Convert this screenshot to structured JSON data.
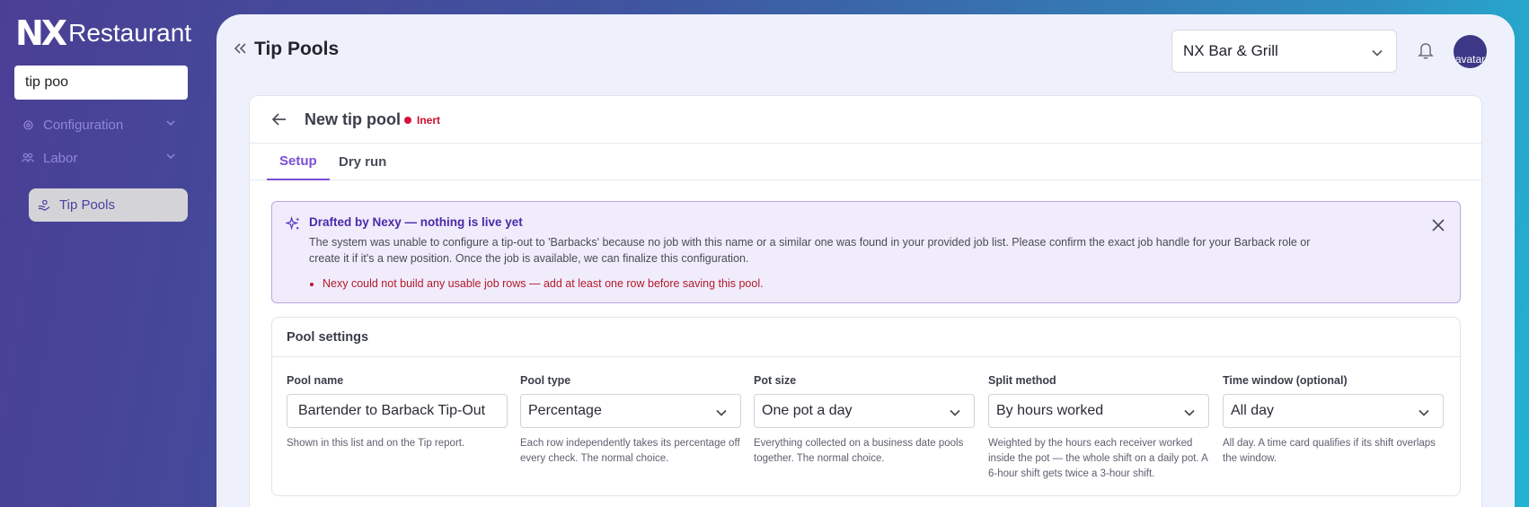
{
  "brand": {
    "logo_mark": "NX",
    "logo_text": "Restaurant"
  },
  "sidebar": {
    "search": {
      "value": "tip poo",
      "placeholder": ""
    },
    "items": [
      {
        "label": "Configuration",
        "icon": "gear-icon"
      },
      {
        "label": "Labor",
        "icon": "people-icon"
      }
    ],
    "active_item": {
      "label": "Tip Pools",
      "icon": "hand-coin-icon"
    }
  },
  "header": {
    "title": "Tip Pools",
    "location": "NX Bar & Grill",
    "avatar_alt": "avatar"
  },
  "card": {
    "title": "New tip pool",
    "status": "Inert",
    "tabs": [
      {
        "label": "Setup",
        "active": true
      },
      {
        "label": "Dry run",
        "active": false
      }
    ]
  },
  "ai_banner": {
    "title": "Drafted by Nexy — nothing is live yet",
    "message": "The system was unable to configure a tip-out to 'Barbacks' because no job with this name or a similar one was found in your provided job list. Please confirm the exact job handle for your Barback role or create it if it's a new position. Once the job is available, we can finalize this configuration.",
    "errors": [
      "Nexy could not build any usable job rows — add at least one row before saving this pool."
    ]
  },
  "pool_settings": {
    "title": "Pool settings",
    "fields": [
      {
        "label": "Pool name",
        "value": "Bartender to Barback Tip-Out",
        "help": "Shown in this list and on the Tip report."
      },
      {
        "label": "Pool type",
        "value": "Percentage",
        "help": "Each row independently takes its percentage off every check. The normal choice."
      },
      {
        "label": "Pot size",
        "value": "One pot a day",
        "help": "Everything collected on a business date pools together. The normal choice."
      },
      {
        "label": "Split method",
        "value": "By hours worked",
        "help": "Weighted by the hours each receiver worked inside the pot — the whole shift on a daily pot. A 6-hour shift gets twice a 3-hour shift."
      },
      {
        "label": "Time window (optional)",
        "value": "All day",
        "help": "All day. A time card qualifies if its shift overlaps the window."
      }
    ]
  },
  "colors": {
    "accent": "#7b4fd6",
    "status_inert": "#c8102e",
    "banner_bg": "#f1ecfb"
  }
}
